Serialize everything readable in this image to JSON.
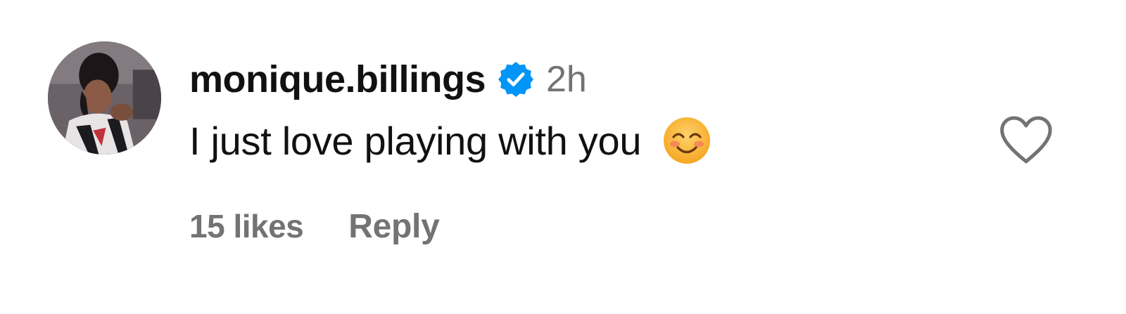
{
  "comment": {
    "username": "monique.billings",
    "verified": true,
    "time": "2h",
    "text": "I just love playing with you",
    "emoji": "smiling-face-with-smiling-eyes-emoji",
    "likes": "15 likes",
    "reply_label": "Reply",
    "liked": false
  },
  "icons": {
    "verified": "verified-badge-icon",
    "like": "heart-outline-icon"
  },
  "colors": {
    "verified_blue": "#0095f6",
    "secondary_text": "#737373",
    "primary_text": "#111111"
  }
}
